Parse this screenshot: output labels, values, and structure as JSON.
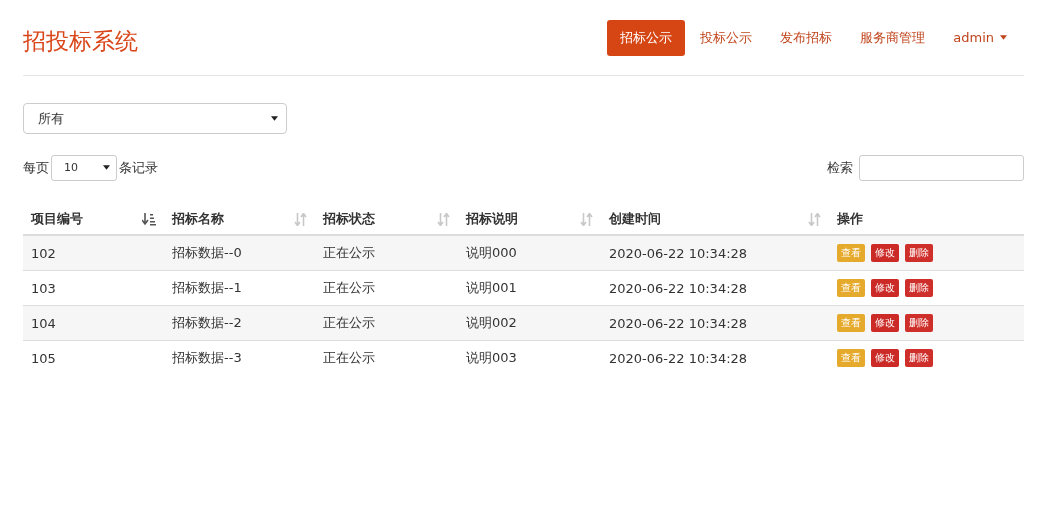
{
  "brand": "招投标系统",
  "nav": [
    {
      "label": "招标公示",
      "selected": true,
      "kind": "link"
    },
    {
      "label": "投标公示",
      "selected": false,
      "kind": "link"
    },
    {
      "label": "发布招标",
      "selected": false,
      "kind": "link"
    },
    {
      "label": "服务商管理",
      "selected": false,
      "kind": "link"
    },
    {
      "label": "admin",
      "selected": false,
      "kind": "dropdown"
    }
  ],
  "filter": {
    "value": "所有"
  },
  "length": {
    "prefix": "每页",
    "value": "10",
    "suffix": "条记录"
  },
  "search": {
    "label": "检索"
  },
  "table": {
    "columns": [
      {
        "label": "项目编号",
        "sorted": true
      },
      {
        "label": "招标名称",
        "sorted": false
      },
      {
        "label": "招标状态",
        "sorted": false
      },
      {
        "label": "招标说明",
        "sorted": false
      },
      {
        "label": "创建时间",
        "sorted": false
      },
      {
        "label": "操作"
      }
    ],
    "rows": [
      {
        "cells": [
          "102",
          "招标数据--0",
          "正在公示",
          "说明000",
          "2020-06-22 10:34:28"
        ],
        "actions": [
          {
            "label": "查看",
            "kind": "view"
          },
          {
            "label": "修改",
            "kind": "edit"
          },
          {
            "label": "删除",
            "kind": "delete"
          }
        ]
      },
      {
        "cells": [
          "103",
          "招标数据--1",
          "正在公示",
          "说明001",
          "2020-06-22 10:34:28"
        ],
        "actions": [
          {
            "label": "查看",
            "kind": "view"
          },
          {
            "label": "修改",
            "kind": "edit"
          },
          {
            "label": "删除",
            "kind": "delete"
          }
        ]
      },
      {
        "cells": [
          "104",
          "招标数据--2",
          "正在公示",
          "说明002",
          "2020-06-22 10:34:28"
        ],
        "actions": [
          {
            "label": "查看",
            "kind": "view"
          },
          {
            "label": "修改",
            "kind": "edit"
          },
          {
            "label": "删除",
            "kind": "delete"
          }
        ]
      },
      {
        "cells": [
          "105",
          "招标数据--3",
          "正在公示",
          "说明003",
          "2020-06-22 10:34:28"
        ],
        "actions": [
          {
            "label": "查看",
            "kind": "view"
          },
          {
            "label": "修改",
            "kind": "edit"
          },
          {
            "label": "删除",
            "kind": "delete"
          }
        ]
      }
    ]
  }
}
